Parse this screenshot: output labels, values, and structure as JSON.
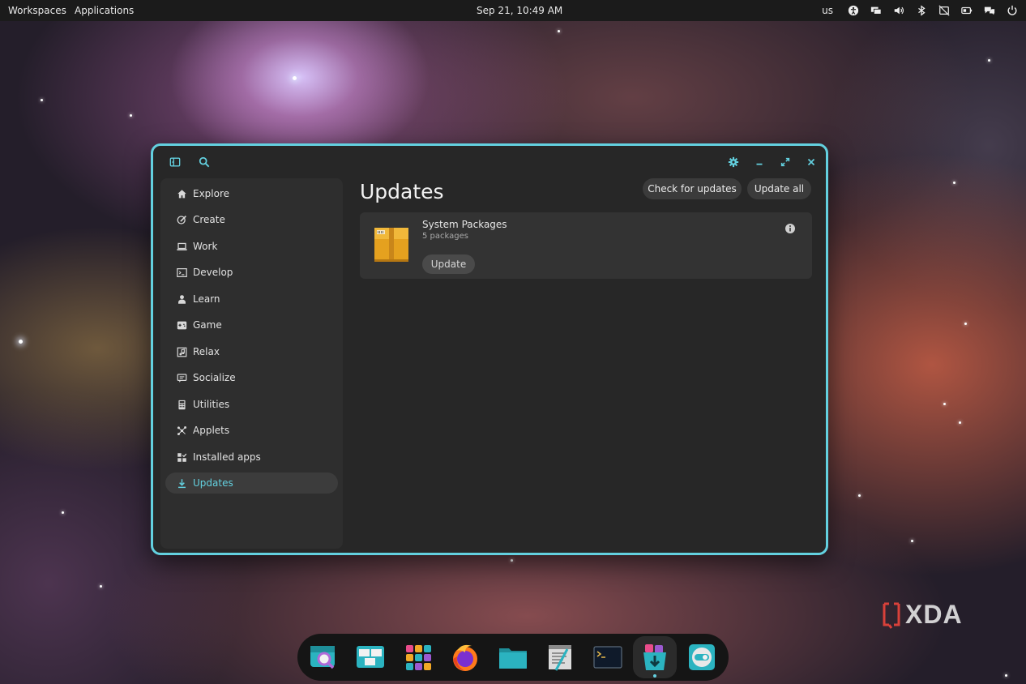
{
  "top_panel": {
    "workspaces": "Workspaces",
    "applications": "Applications",
    "clock": "Sep 21, 10:49 AM",
    "keyboard_layout": "us",
    "tray_icons": [
      "accessibility-icon",
      "displays-icon",
      "volume-icon",
      "bluetooth-icon",
      "notifications-off-icon",
      "battery-icon",
      "messages-icon",
      "power-icon"
    ]
  },
  "window": {
    "header_icons": [
      "sidebar-toggle-icon",
      "search-icon",
      "settings-gear-icon",
      "minimize-icon",
      "maximize-icon",
      "close-icon"
    ],
    "accent_color": "#63d0df",
    "sidebar": {
      "items": [
        {
          "label": "Explore",
          "icon": "home-icon"
        },
        {
          "label": "Create",
          "icon": "brush-icon"
        },
        {
          "label": "Work",
          "icon": "laptop-icon"
        },
        {
          "label": "Develop",
          "icon": "terminal-icon"
        },
        {
          "label": "Learn",
          "icon": "person-icon"
        },
        {
          "label": "Game",
          "icon": "gamepad-icon"
        },
        {
          "label": "Relax",
          "icon": "music-icon"
        },
        {
          "label": "Socialize",
          "icon": "chat-icon"
        },
        {
          "label": "Utilities",
          "icon": "calculator-icon"
        },
        {
          "label": "Applets",
          "icon": "applets-icon"
        },
        {
          "label": "Installed apps",
          "icon": "installed-apps-icon"
        },
        {
          "label": "Updates",
          "icon": "download-icon",
          "active": true
        }
      ]
    },
    "main": {
      "title": "Updates",
      "check_button": "Check for updates",
      "update_all_button": "Update all",
      "card": {
        "title": "System Packages",
        "subtitle": "5 packages",
        "update_button": "Update"
      }
    }
  },
  "dock": {
    "apps": [
      "launcher-search-icon",
      "workspaces-overview-icon",
      "app-grid-icon",
      "firefox-icon",
      "files-folder-icon",
      "text-editor-icon",
      "terminal-app-icon",
      "cosmic-store-icon",
      "settings-toggle-icon"
    ],
    "active_app": "cosmic-store-icon"
  },
  "watermark": {
    "text": "XDA"
  }
}
